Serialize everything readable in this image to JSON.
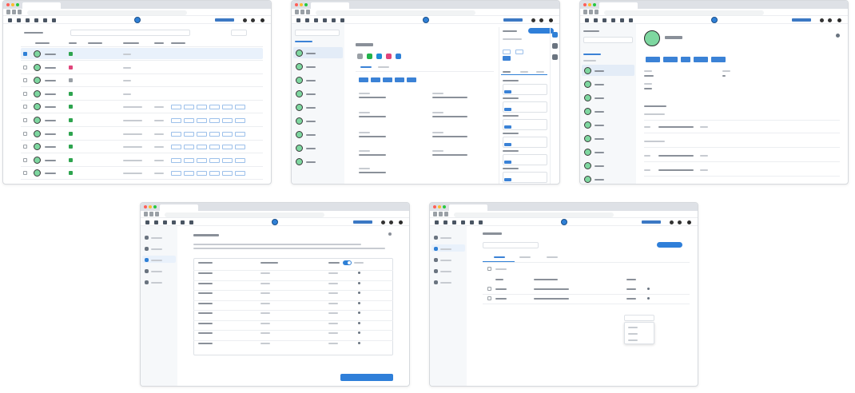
{
  "screens": [
    {
      "name": "customer-list",
      "description_role": "list"
    },
    {
      "name": "customer-detail",
      "description_role": "detail"
    },
    {
      "name": "permission-group",
      "description_role": "group"
    },
    {
      "name": "edit-permissions-dialog",
      "description_role": "dialog"
    },
    {
      "name": "member-management",
      "description_role": "members"
    }
  ],
  "colors": {
    "accent": "#2f80d6",
    "avatar_green": "#7ed7a0",
    "chip_blue": "#3b82d6",
    "page_bg": "#ffffff"
  },
  "icons": [
    "chat-icon",
    "tools-icon",
    "user-icon",
    "grid-icon",
    "link-icon",
    "mail-icon",
    "moon-icon",
    "bell-icon",
    "avatar-icon",
    "gear-icon",
    "search-icon",
    "close-icon"
  ]
}
